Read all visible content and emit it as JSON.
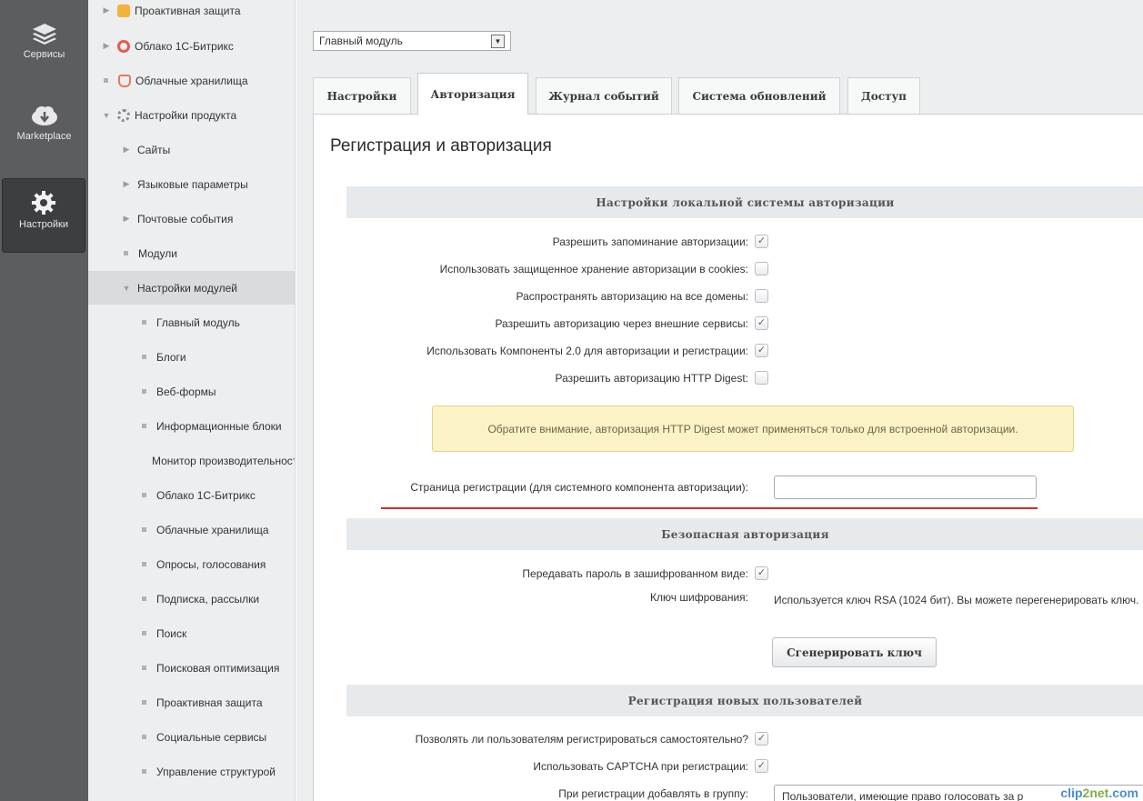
{
  "leftbar": {
    "items": [
      {
        "label": "Сервисы",
        "icon": "layers-icon"
      },
      {
        "label": "Marketplace",
        "icon": "cloud-download-icon"
      },
      {
        "label": "Настройки",
        "icon": "gear-icon"
      }
    ]
  },
  "tree": {
    "items": [
      {
        "label": "Проактивная защита"
      },
      {
        "label": "Облако 1С-Битрикс"
      },
      {
        "label": "Облачные хранилища"
      },
      {
        "label": "Настройки продукта"
      },
      {
        "label": "Сайты"
      },
      {
        "label": "Языковые параметры"
      },
      {
        "label": "Почтовые события"
      },
      {
        "label": "Модули"
      },
      {
        "label": "Настройки модулей"
      },
      {
        "label": "Главный модуль"
      },
      {
        "label": "Блоги"
      },
      {
        "label": "Веб-формы"
      },
      {
        "label": "Информационные блоки"
      },
      {
        "label": "Монитор производительности"
      },
      {
        "label": "Облако 1С-Битрикс"
      },
      {
        "label": "Облачные хранилища"
      },
      {
        "label": "Опросы, голосования"
      },
      {
        "label": "Подписка, рассылки"
      },
      {
        "label": "Поиск"
      },
      {
        "label": "Поисковая оптимизация"
      },
      {
        "label": "Проактивная защита"
      },
      {
        "label": "Социальные сервисы"
      },
      {
        "label": "Управление структурой"
      }
    ]
  },
  "module_select": {
    "value": "Главный модуль"
  },
  "tabs": [
    {
      "label": "Настройки"
    },
    {
      "label": "Авторизация"
    },
    {
      "label": "Журнал событий"
    },
    {
      "label": "Система обновлений"
    },
    {
      "label": "Доступ"
    }
  ],
  "page_title": "Регистрация и авторизация",
  "sections": {
    "local_auth": {
      "title": "Настройки локальной системы авторизации",
      "options": [
        {
          "label": "Разрешить запоминание авторизации:",
          "checked": true
        },
        {
          "label": "Использовать защищенное хранение авторизации в cookies:",
          "checked": false
        },
        {
          "label": "Распространять авторизацию на все домены:",
          "checked": false
        },
        {
          "label": "Разрешить авторизацию через внешние сервисы:",
          "checked": true
        },
        {
          "label": "Использовать Компоненты 2.0 для авторизации и регистрации:",
          "checked": true
        },
        {
          "label": "Разрешить авторизацию HTTP Digest:",
          "checked": false
        }
      ],
      "notice": "Обратите внимание, авторизация HTTP Digest может применяться только для встроенной авторизации.",
      "reg_page_label": "Страница регистрации (для системного компонента авторизации):",
      "reg_page_value": ""
    },
    "secure_auth": {
      "title": "Безопасная авторизация",
      "encrypt_label": "Передавать пароль в зашифрованном виде:",
      "encrypt_checked": true,
      "key_label": "Ключ шифрования:",
      "key_text": "Используется ключ RSA (1024 бит). Вы можете перегенерировать ключ.",
      "generate_button": "Сгенерировать ключ"
    },
    "new_users": {
      "title": "Регистрация новых пользователей",
      "options": [
        {
          "label": "Позволять ли пользователям регистрироваться самостоятельно?",
          "checked": true
        },
        {
          "label": "Использовать CAPTCHA при регистрации:",
          "checked": true
        }
      ],
      "group_label": "При регистрации добавлять в группу:",
      "group_value": "Пользователи, имеющие право голосовать за р"
    }
  },
  "watermark": {
    "a": "clip",
    "b": "2",
    "c": "net",
    "d": ".com"
  },
  "check_mark": "✓"
}
